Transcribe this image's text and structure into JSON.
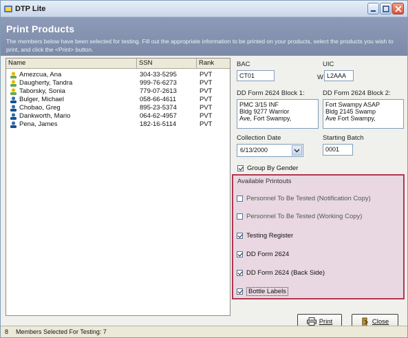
{
  "window": {
    "title": "DTP Lite"
  },
  "header": {
    "title": "Print Products",
    "description": "The members below have been selected for testing. Fill out the appropriate information to be printed on your products, select the products you wish to print, and click the <Print> button."
  },
  "members": {
    "columns": [
      "Name",
      "SSN",
      "Rank"
    ],
    "rows": [
      {
        "name": "Amezcua, Ana",
        "ssn": "304-33-5295",
        "rank": "PVT",
        "icon": "female-user-icon"
      },
      {
        "name": "Daugherty, Tandra",
        "ssn": "999-76-6273",
        "rank": "PVT",
        "icon": "female-user-icon"
      },
      {
        "name": "Taborsky, Sonia",
        "ssn": "779-07-2613",
        "rank": "PVT",
        "icon": "female-user-icon"
      },
      {
        "name": "Bulger, Michael",
        "ssn": "058-66-4611",
        "rank": "PVT",
        "icon": "male-user-icon"
      },
      {
        "name": "Chobao, Greg",
        "ssn": "895-23-5374",
        "rank": "PVT",
        "icon": "male-user-icon"
      },
      {
        "name": "Dankworth, Mario",
        "ssn": "064-62-4957",
        "rank": "PVT",
        "icon": "male-user-icon"
      },
      {
        "name": "Pena, James",
        "ssn": "182-16-5114",
        "rank": "PVT",
        "icon": "male-user-icon"
      }
    ]
  },
  "form": {
    "bac_label": "BAC",
    "bac_value": "CT01",
    "uic_label": "UIC",
    "uic_prefix": "W",
    "uic_value": "L2AAA",
    "block1_label": "DD Form 2624 Block 1:",
    "block1_value": "PMC 3/15 INF\nBldg 9277 Warrior\nAve, Fort Swampy,",
    "block2_label": "DD Form 2624 Block 2:",
    "block2_value": "Fort Swampy ASAP\nBldg 2145 Swamp\nAve Fort Swampy,",
    "collection_date_label": "Collection Date",
    "collection_date_value": "6/13/2000",
    "starting_batch_label": "Starting Batch",
    "starting_batch_value": "0001",
    "group_by_gender_label": "Group By Gender",
    "group_by_gender_checked": true
  },
  "printouts": {
    "title": "Available Printouts",
    "items": [
      {
        "label": "Personnel To Be Tested (Notification Copy)",
        "checked": false
      },
      {
        "label": "Personnel To Be Tested (Working Copy)",
        "checked": false
      },
      {
        "label": "Testing Register",
        "checked": true
      },
      {
        "label": "DD Form 2624",
        "checked": true
      },
      {
        "label": "DD Form 2624 (Back Side)",
        "checked": true
      },
      {
        "label": "Bottle Labels",
        "checked": true
      }
    ]
  },
  "buttons": {
    "print": "Print",
    "close": "Close"
  },
  "status": {
    "count": "8",
    "text": "Members Selected For Testing: 7"
  },
  "colors": {
    "accent": "#b3344e",
    "highlight": "#e9d8e1",
    "header": "#8592b0"
  }
}
